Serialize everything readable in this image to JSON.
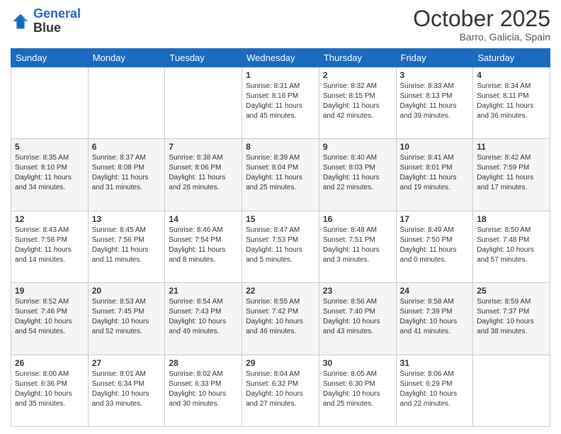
{
  "header": {
    "logo_line1": "General",
    "logo_line2": "Blue",
    "month": "October 2025",
    "location": "Barro, Galicia, Spain"
  },
  "days_of_week": [
    "Sunday",
    "Monday",
    "Tuesday",
    "Wednesday",
    "Thursday",
    "Friday",
    "Saturday"
  ],
  "weeks": [
    [
      {
        "day": "",
        "sunrise": "",
        "sunset": "",
        "daylight": ""
      },
      {
        "day": "",
        "sunrise": "",
        "sunset": "",
        "daylight": ""
      },
      {
        "day": "",
        "sunrise": "",
        "sunset": "",
        "daylight": ""
      },
      {
        "day": "1",
        "sunrise": "Sunrise: 8:31 AM",
        "sunset": "Sunset: 8:16 PM",
        "daylight": "Daylight: 11 hours and 45 minutes."
      },
      {
        "day": "2",
        "sunrise": "Sunrise: 8:32 AM",
        "sunset": "Sunset: 8:15 PM",
        "daylight": "Daylight: 11 hours and 42 minutes."
      },
      {
        "day": "3",
        "sunrise": "Sunrise: 8:33 AM",
        "sunset": "Sunset: 8:13 PM",
        "daylight": "Daylight: 11 hours and 39 minutes."
      },
      {
        "day": "4",
        "sunrise": "Sunrise: 8:34 AM",
        "sunset": "Sunset: 8:11 PM",
        "daylight": "Daylight: 11 hours and 36 minutes."
      }
    ],
    [
      {
        "day": "5",
        "sunrise": "Sunrise: 8:35 AM",
        "sunset": "Sunset: 8:10 PM",
        "daylight": "Daylight: 11 hours and 34 minutes."
      },
      {
        "day": "6",
        "sunrise": "Sunrise: 8:37 AM",
        "sunset": "Sunset: 8:08 PM",
        "daylight": "Daylight: 11 hours and 31 minutes."
      },
      {
        "day": "7",
        "sunrise": "Sunrise: 8:38 AM",
        "sunset": "Sunset: 8:06 PM",
        "daylight": "Daylight: 11 hours and 28 minutes."
      },
      {
        "day": "8",
        "sunrise": "Sunrise: 8:39 AM",
        "sunset": "Sunset: 8:04 PM",
        "daylight": "Daylight: 11 hours and 25 minutes."
      },
      {
        "day": "9",
        "sunrise": "Sunrise: 8:40 AM",
        "sunset": "Sunset: 8:03 PM",
        "daylight": "Daylight: 11 hours and 22 minutes."
      },
      {
        "day": "10",
        "sunrise": "Sunrise: 8:41 AM",
        "sunset": "Sunset: 8:01 PM",
        "daylight": "Daylight: 11 hours and 19 minutes."
      },
      {
        "day": "11",
        "sunrise": "Sunrise: 8:42 AM",
        "sunset": "Sunset: 7:59 PM",
        "daylight": "Daylight: 11 hours and 17 minutes."
      }
    ],
    [
      {
        "day": "12",
        "sunrise": "Sunrise: 8:43 AM",
        "sunset": "Sunset: 7:58 PM",
        "daylight": "Daylight: 11 hours and 14 minutes."
      },
      {
        "day": "13",
        "sunrise": "Sunrise: 8:45 AM",
        "sunset": "Sunset: 7:56 PM",
        "daylight": "Daylight: 11 hours and 11 minutes."
      },
      {
        "day": "14",
        "sunrise": "Sunrise: 8:46 AM",
        "sunset": "Sunset: 7:54 PM",
        "daylight": "Daylight: 11 hours and 8 minutes."
      },
      {
        "day": "15",
        "sunrise": "Sunrise: 8:47 AM",
        "sunset": "Sunset: 7:53 PM",
        "daylight": "Daylight: 11 hours and 5 minutes."
      },
      {
        "day": "16",
        "sunrise": "Sunrise: 8:48 AM",
        "sunset": "Sunset: 7:51 PM",
        "daylight": "Daylight: 11 hours and 3 minutes."
      },
      {
        "day": "17",
        "sunrise": "Sunrise: 8:49 AM",
        "sunset": "Sunset: 7:50 PM",
        "daylight": "Daylight: 11 hours and 0 minutes."
      },
      {
        "day": "18",
        "sunrise": "Sunrise: 8:50 AM",
        "sunset": "Sunset: 7:48 PM",
        "daylight": "Daylight: 10 hours and 57 minutes."
      }
    ],
    [
      {
        "day": "19",
        "sunrise": "Sunrise: 8:52 AM",
        "sunset": "Sunset: 7:46 PM",
        "daylight": "Daylight: 10 hours and 54 minutes."
      },
      {
        "day": "20",
        "sunrise": "Sunrise: 8:53 AM",
        "sunset": "Sunset: 7:45 PM",
        "daylight": "Daylight: 10 hours and 52 minutes."
      },
      {
        "day": "21",
        "sunrise": "Sunrise: 8:54 AM",
        "sunset": "Sunset: 7:43 PM",
        "daylight": "Daylight: 10 hours and 49 minutes."
      },
      {
        "day": "22",
        "sunrise": "Sunrise: 8:55 AM",
        "sunset": "Sunset: 7:42 PM",
        "daylight": "Daylight: 10 hours and 46 minutes."
      },
      {
        "day": "23",
        "sunrise": "Sunrise: 8:56 AM",
        "sunset": "Sunset: 7:40 PM",
        "daylight": "Daylight: 10 hours and 43 minutes."
      },
      {
        "day": "24",
        "sunrise": "Sunrise: 8:58 AM",
        "sunset": "Sunset: 7:39 PM",
        "daylight": "Daylight: 10 hours and 41 minutes."
      },
      {
        "day": "25",
        "sunrise": "Sunrise: 8:59 AM",
        "sunset": "Sunset: 7:37 PM",
        "daylight": "Daylight: 10 hours and 38 minutes."
      }
    ],
    [
      {
        "day": "26",
        "sunrise": "Sunrise: 8:00 AM",
        "sunset": "Sunset: 6:36 PM",
        "daylight": "Daylight: 10 hours and 35 minutes."
      },
      {
        "day": "27",
        "sunrise": "Sunrise: 8:01 AM",
        "sunset": "Sunset: 6:34 PM",
        "daylight": "Daylight: 10 hours and 33 minutes."
      },
      {
        "day": "28",
        "sunrise": "Sunrise: 8:02 AM",
        "sunset": "Sunset: 6:33 PM",
        "daylight": "Daylight: 10 hours and 30 minutes."
      },
      {
        "day": "29",
        "sunrise": "Sunrise: 8:04 AM",
        "sunset": "Sunset: 6:32 PM",
        "daylight": "Daylight: 10 hours and 27 minutes."
      },
      {
        "day": "30",
        "sunrise": "Sunrise: 8:05 AM",
        "sunset": "Sunset: 6:30 PM",
        "daylight": "Daylight: 10 hours and 25 minutes."
      },
      {
        "day": "31",
        "sunrise": "Sunrise: 8:06 AM",
        "sunset": "Sunset: 6:29 PM",
        "daylight": "Daylight: 10 hours and 22 minutes."
      },
      {
        "day": "",
        "sunrise": "",
        "sunset": "",
        "daylight": ""
      }
    ]
  ]
}
